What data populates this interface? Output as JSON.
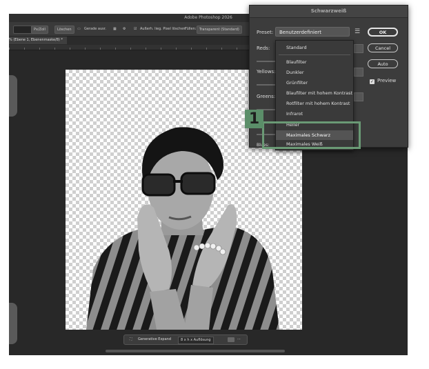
{
  "app": {
    "title": "Adobe Photoshop 2026"
  },
  "options_bar": {
    "unit_value": "Px/Zoll",
    "delete_button": "Löschen",
    "straighten": "Gerade ausr.",
    "delete_cropped": "Außerh. lieg. Pixel löschen",
    "fill_label": "Füllen:",
    "fill_value": "Transparent (Standard)"
  },
  "document_tab": {
    "label": "% (Ebene 1, Ebenenmaske/8) *"
  },
  "context_bar": {
    "generative_expand": "Generative Expand",
    "resolution": "8 x h x Auflösung",
    "more": "···"
  },
  "dialog": {
    "title": "Schwarzweiß",
    "preset_label": "Preset:",
    "preset_value": "Benutzerdefiniert",
    "reds_label": "Reds:",
    "yellows_label": "Yellows:",
    "greens_label": "Greens:",
    "blues_label": "Blues:",
    "ok_button": "OK",
    "cancel_button": "Cancel",
    "auto_button": "Auto",
    "preview_label": "Preview",
    "preview_checked": true
  },
  "preset_menu": {
    "items": [
      "Standard",
      "Blaufilter",
      "Dunkler",
      "Grünfilter",
      "Blaufilter mit hohem Kontrast",
      "Rotfilter mit hohem Kontrast",
      "Infrarot",
      "Heller",
      "Maximales Schwarz",
      "Maximales Weiß"
    ],
    "highlighted": "Maximales Schwarz"
  },
  "callout": {
    "number": "1",
    "color": "#5b8e69"
  },
  "colors": {
    "ui_dark": "#2b2b2b",
    "dialog_bg": "#3c3c3c",
    "callout_green": "#6a9a75"
  }
}
